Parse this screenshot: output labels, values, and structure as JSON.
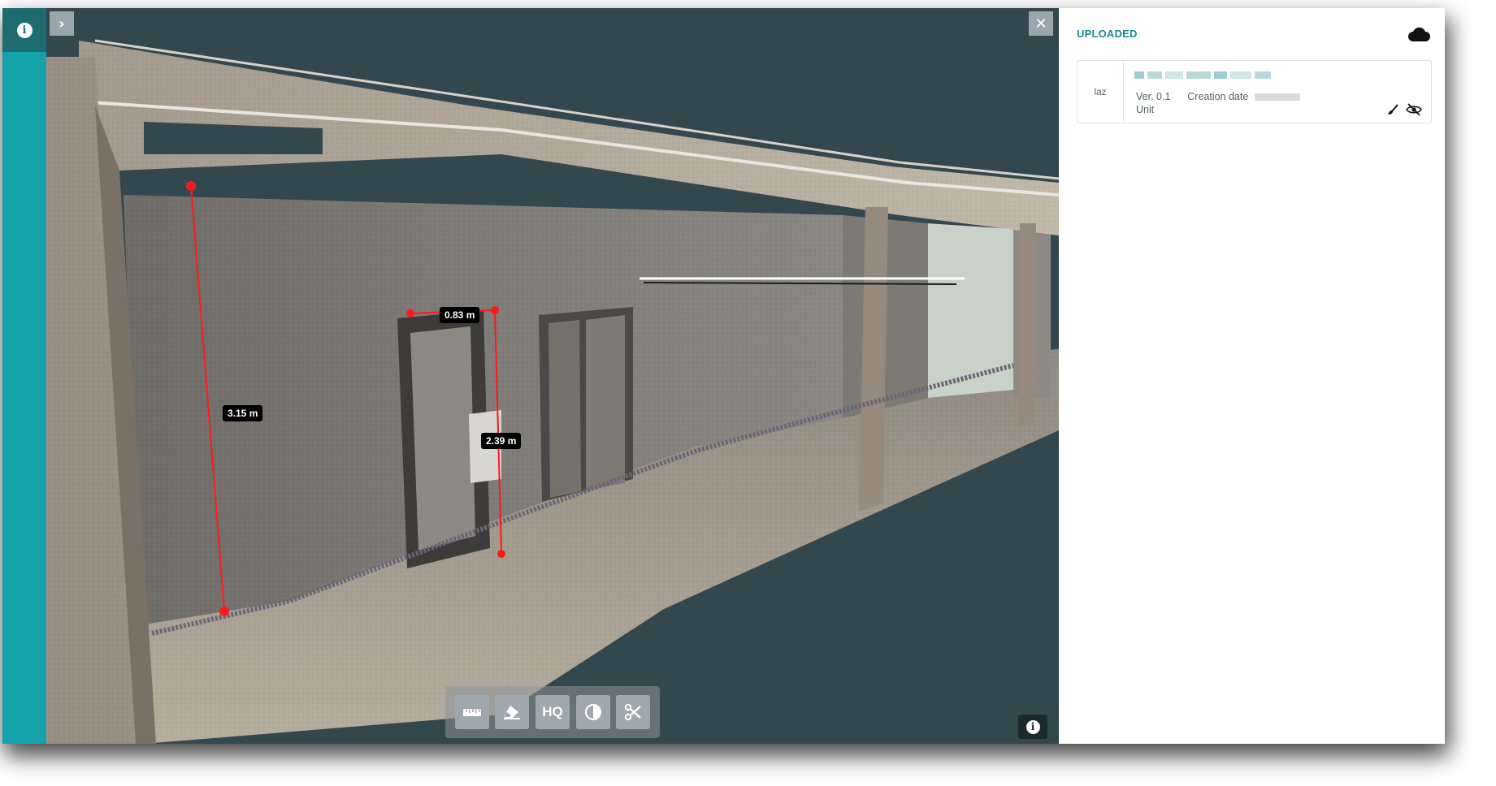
{
  "panel": {
    "title": "UPLOADED",
    "cloud_icon": "cloud-icon"
  },
  "file_card": {
    "format": "laz",
    "name_obscured": true,
    "version": "Ver. 0.1",
    "creation_date_label": "Creation date",
    "creation_date_obscured": true,
    "unit_label": "Unit",
    "actions": [
      "brush-icon",
      "eye-slash-icon"
    ]
  },
  "viewer": {
    "measurements": [
      {
        "id": "height-left",
        "label": "3.15 m"
      },
      {
        "id": "door-width",
        "label": "0.83 m"
      },
      {
        "id": "door-height",
        "label": "2.39 m"
      }
    ],
    "toolbar": {
      "buttons": [
        {
          "id": "measure",
          "icon": "ruler-icon",
          "label": ""
        },
        {
          "id": "erase",
          "icon": "eraser-icon",
          "label": ""
        },
        {
          "id": "quality",
          "icon": "",
          "label": "HQ"
        },
        {
          "id": "contrast",
          "icon": "contrast-icon",
          "label": ""
        },
        {
          "id": "clip",
          "icon": "scissors-icon",
          "label": ""
        }
      ]
    },
    "info_icon": "info-icon",
    "close_icon": "close-icon",
    "expand_icon": "chevron-right-icon"
  },
  "sidebar": {
    "info_icon": "info-icon"
  },
  "colors": {
    "accent": "#14a3a8",
    "accent_dark": "#1d6d70",
    "viewer_bg": "#33474f",
    "measure_line": "#ff1a1a",
    "panel_title": "#1a8a8f"
  }
}
